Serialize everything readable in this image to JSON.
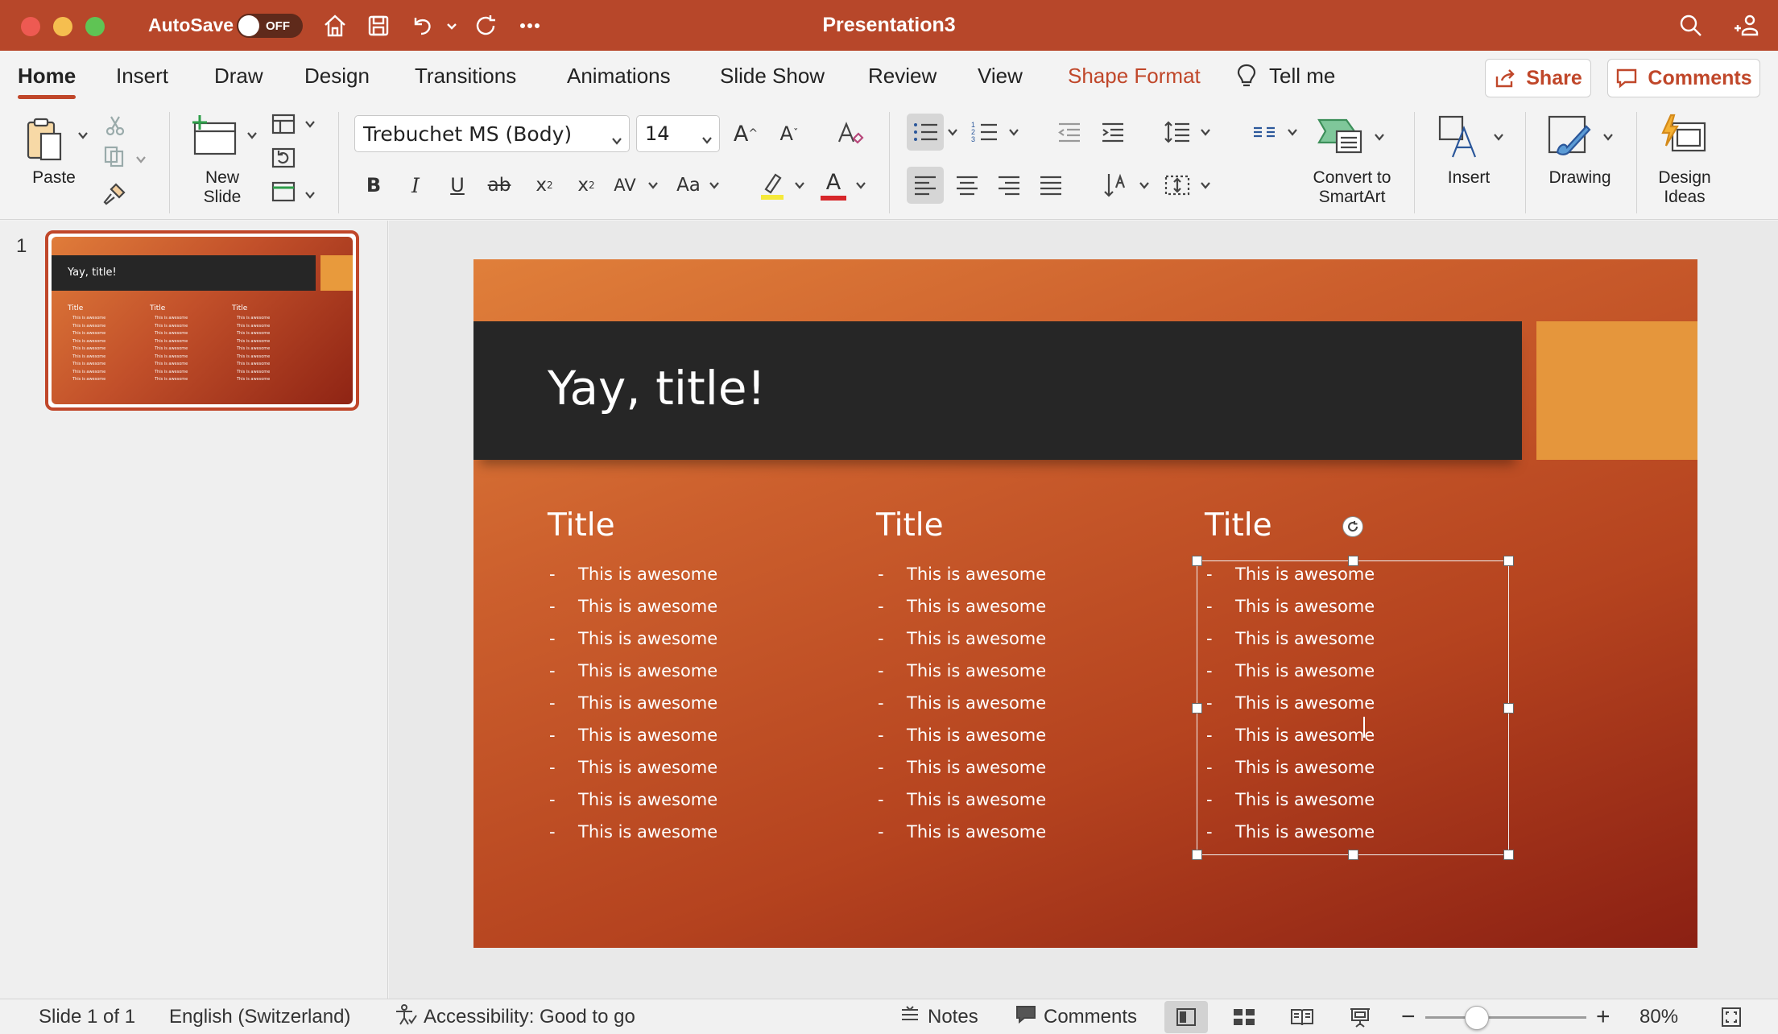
{
  "titlebar": {
    "autosave_label": "AutoSave",
    "autosave_state": "OFF",
    "document_title": "Presentation3"
  },
  "tabs": [
    {
      "label": "Home"
    },
    {
      "label": "Insert"
    },
    {
      "label": "Draw"
    },
    {
      "label": "Design"
    },
    {
      "label": "Transitions"
    },
    {
      "label": "Animations"
    },
    {
      "label": "Slide Show"
    },
    {
      "label": "Review"
    },
    {
      "label": "View"
    },
    {
      "label": "Shape Format"
    }
  ],
  "tell_me": "Tell me",
  "share_label": "Share",
  "comments_label": "Comments",
  "ribbon": {
    "paste_label": "Paste",
    "new_slide_label": "New Slide",
    "font_name": "Trebuchet MS (Body)",
    "font_size": "14",
    "convert_smartart_label": "Convert to SmartArt",
    "insert_label": "Insert",
    "drawing_label": "Drawing",
    "design_ideas_label": "Design Ideas",
    "bold": "B",
    "italic": "I",
    "underline": "U",
    "strike": "ab",
    "superscript": "x",
    "subscript": "x",
    "spacing": "AV",
    "change_case": "Aa",
    "font_color_letter": "A",
    "grow_font": "A",
    "shrink_font": "A"
  },
  "thumbnail": {
    "slide_number": "1",
    "title": "Yay, title!",
    "col_title": "Title",
    "line": "This is awesome"
  },
  "slide": {
    "title": "Yay, title!",
    "columns": [
      {
        "title": "Title",
        "items": [
          "This is awesome",
          "This is awesome",
          "This is awesome",
          "This is awesome",
          "This is awesome",
          "This is awesome",
          "This is awesome",
          "This is awesome",
          "This is awesome"
        ]
      },
      {
        "title": "Title",
        "items": [
          "This is awesome",
          "This is awesome",
          "This is awesome",
          "This is awesome",
          "This is awesome",
          "This is awesome",
          "This is awesome",
          "This is awesome",
          "This is awesome"
        ]
      },
      {
        "title": "Title",
        "items": [
          "This is awesome",
          "This is awesome",
          "This is awesome",
          "This is awesome",
          "This is awesome",
          "This is awesome",
          "This is awesome",
          "This is awesome",
          "This is awesome"
        ]
      }
    ],
    "bullet": "-"
  },
  "statusbar": {
    "slide_info": "Slide 1 of 1",
    "language": "English (Switzerland)",
    "accessibility": "Accessibility: Good to go",
    "notes_label": "Notes",
    "comments_label": "Comments",
    "zoom_minus": "−",
    "zoom_plus": "+",
    "zoom_level": "80%",
    "zoom_fraction": 0.32
  },
  "colors": {
    "brand": "#b7472a",
    "accent": "#c0472a",
    "slide_bar": "#262626",
    "slide_accent": "#e5963c"
  },
  "icons": [
    "home-icon",
    "save-icon",
    "undo-icon",
    "redo-icon",
    "more-icon",
    "search-icon",
    "profile-icon",
    "lightbulb-icon",
    "share-icon",
    "comment-icon"
  ]
}
